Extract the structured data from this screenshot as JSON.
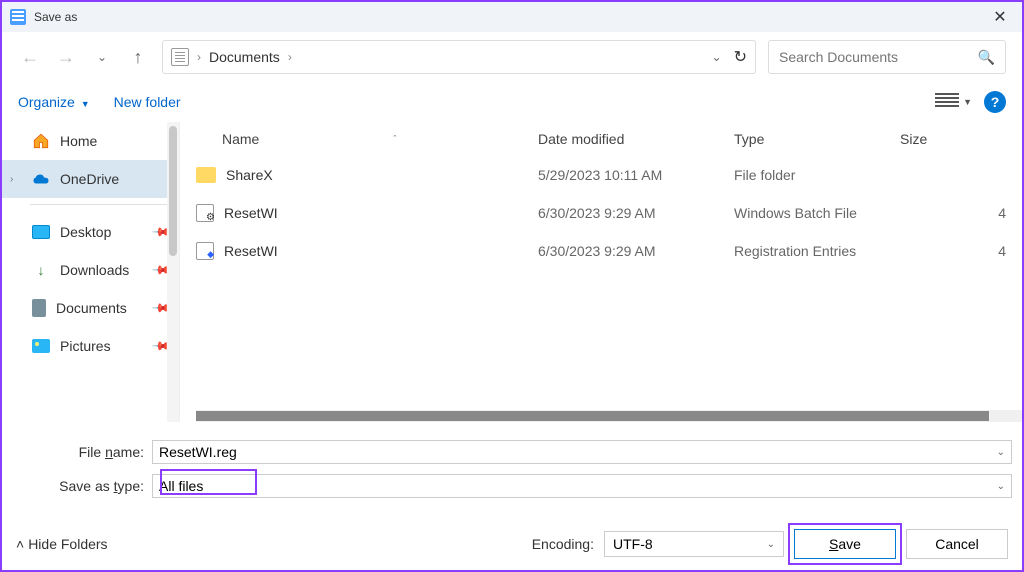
{
  "titlebar": {
    "title": "Save as"
  },
  "navbar": {
    "breadcrumb": "Documents",
    "search_placeholder": "Search Documents"
  },
  "toolbar": {
    "organize": "Organize",
    "new_folder": "New folder"
  },
  "sidebar": {
    "home": "Home",
    "onedrive": "OneDrive",
    "quick": [
      {
        "label": "Desktop"
      },
      {
        "label": "Downloads"
      },
      {
        "label": "Documents"
      },
      {
        "label": "Pictures"
      }
    ]
  },
  "columns": {
    "name": "Name",
    "date": "Date modified",
    "type": "Type",
    "size": "Size"
  },
  "files": [
    {
      "name": "ShareX",
      "date": "5/29/2023 10:11 AM",
      "type": "File folder",
      "size": "",
      "icon": "folder"
    },
    {
      "name": "ResetWI",
      "date": "6/30/2023 9:29 AM",
      "type": "Windows Batch File",
      "size": "4",
      "icon": "bat"
    },
    {
      "name": "ResetWI",
      "date": "6/30/2023 9:29 AM",
      "type": "Registration Entries",
      "size": "4",
      "icon": "reg"
    }
  ],
  "inputs": {
    "filename_label": "File name:",
    "filename_value": "ResetWI.reg",
    "saveastype_label": "Save as type:",
    "saveastype_value": "All files"
  },
  "bottom": {
    "hide_folders": "Hide Folders",
    "encoding_label": "Encoding:",
    "encoding_value": "UTF-8",
    "save": "Save",
    "cancel": "Cancel"
  }
}
